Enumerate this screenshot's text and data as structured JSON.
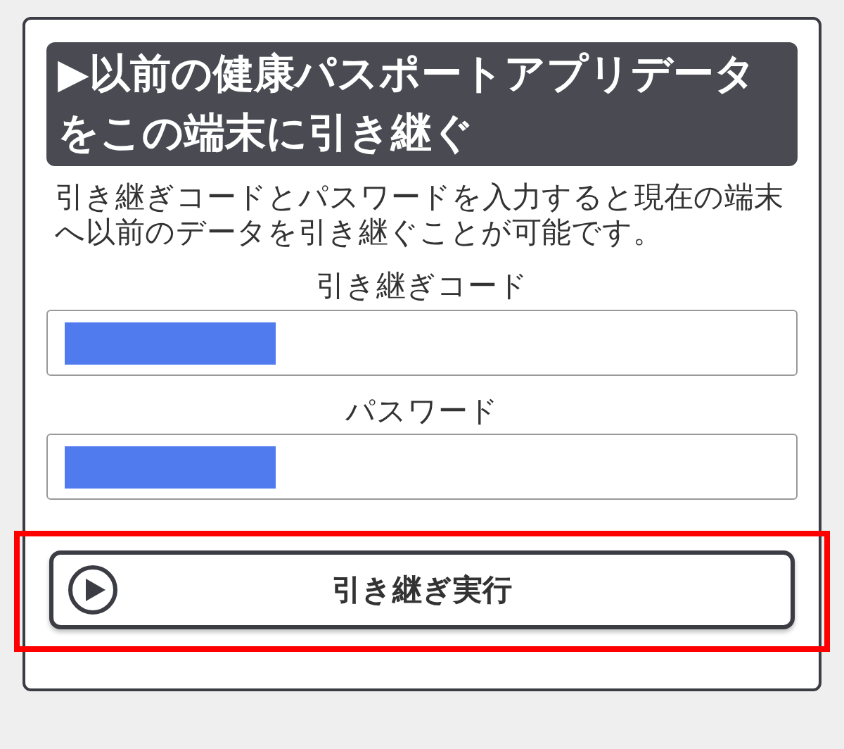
{
  "heading": "▶以前の健康パスポートアプリデータをこの端末に引き継ぐ",
  "description": "引き継ぎコードとパスワードを入力すると現在の端末へ以前のデータを引き継ぐことが可能です。",
  "fields": [
    {
      "label": "引き継ぎコード",
      "redacted": true
    },
    {
      "label": "パスワード",
      "redacted": true
    }
  ],
  "button": {
    "label": "引き継ぎ実行",
    "highlighted": true
  }
}
